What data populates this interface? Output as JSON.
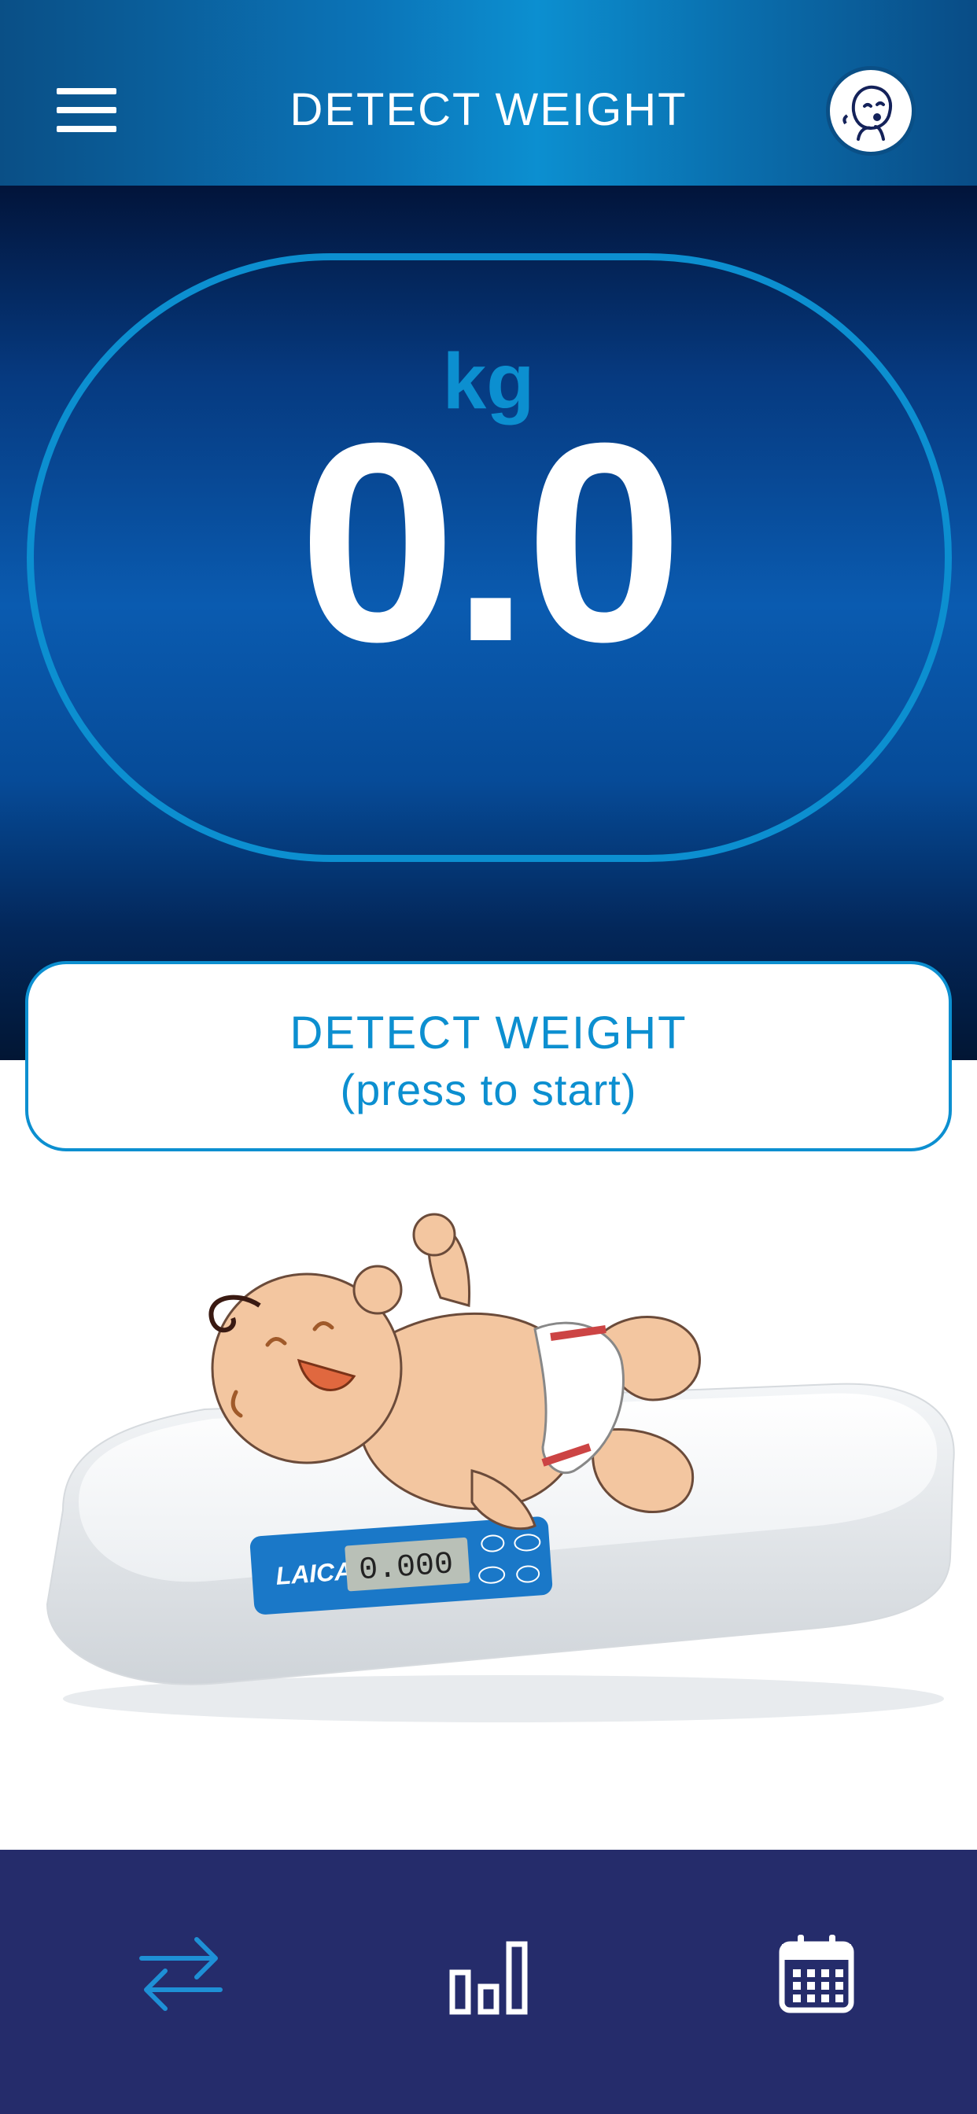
{
  "header": {
    "title": "DETECT WEIGHT",
    "menu_icon": "hamburger-menu-icon",
    "avatar_icon": "baby-avatar-icon"
  },
  "display": {
    "unit": "kg",
    "weight": "0.0"
  },
  "detect_button": {
    "line1": "DETECT WEIGHT",
    "line2": "(press to start)"
  },
  "illustration": {
    "scale_brand": "LAICA",
    "scale_reading": "0.000"
  },
  "tabbar": {
    "items": [
      {
        "icon": "sync-arrows-icon"
      },
      {
        "icon": "bar-chart-icon"
      },
      {
        "icon": "calendar-icon"
      }
    ]
  },
  "colors": {
    "accent": "#0c8fd0",
    "header_dark": "#0a4f86",
    "display_dark": "#02143a",
    "tabbar": "#252c6b"
  }
}
